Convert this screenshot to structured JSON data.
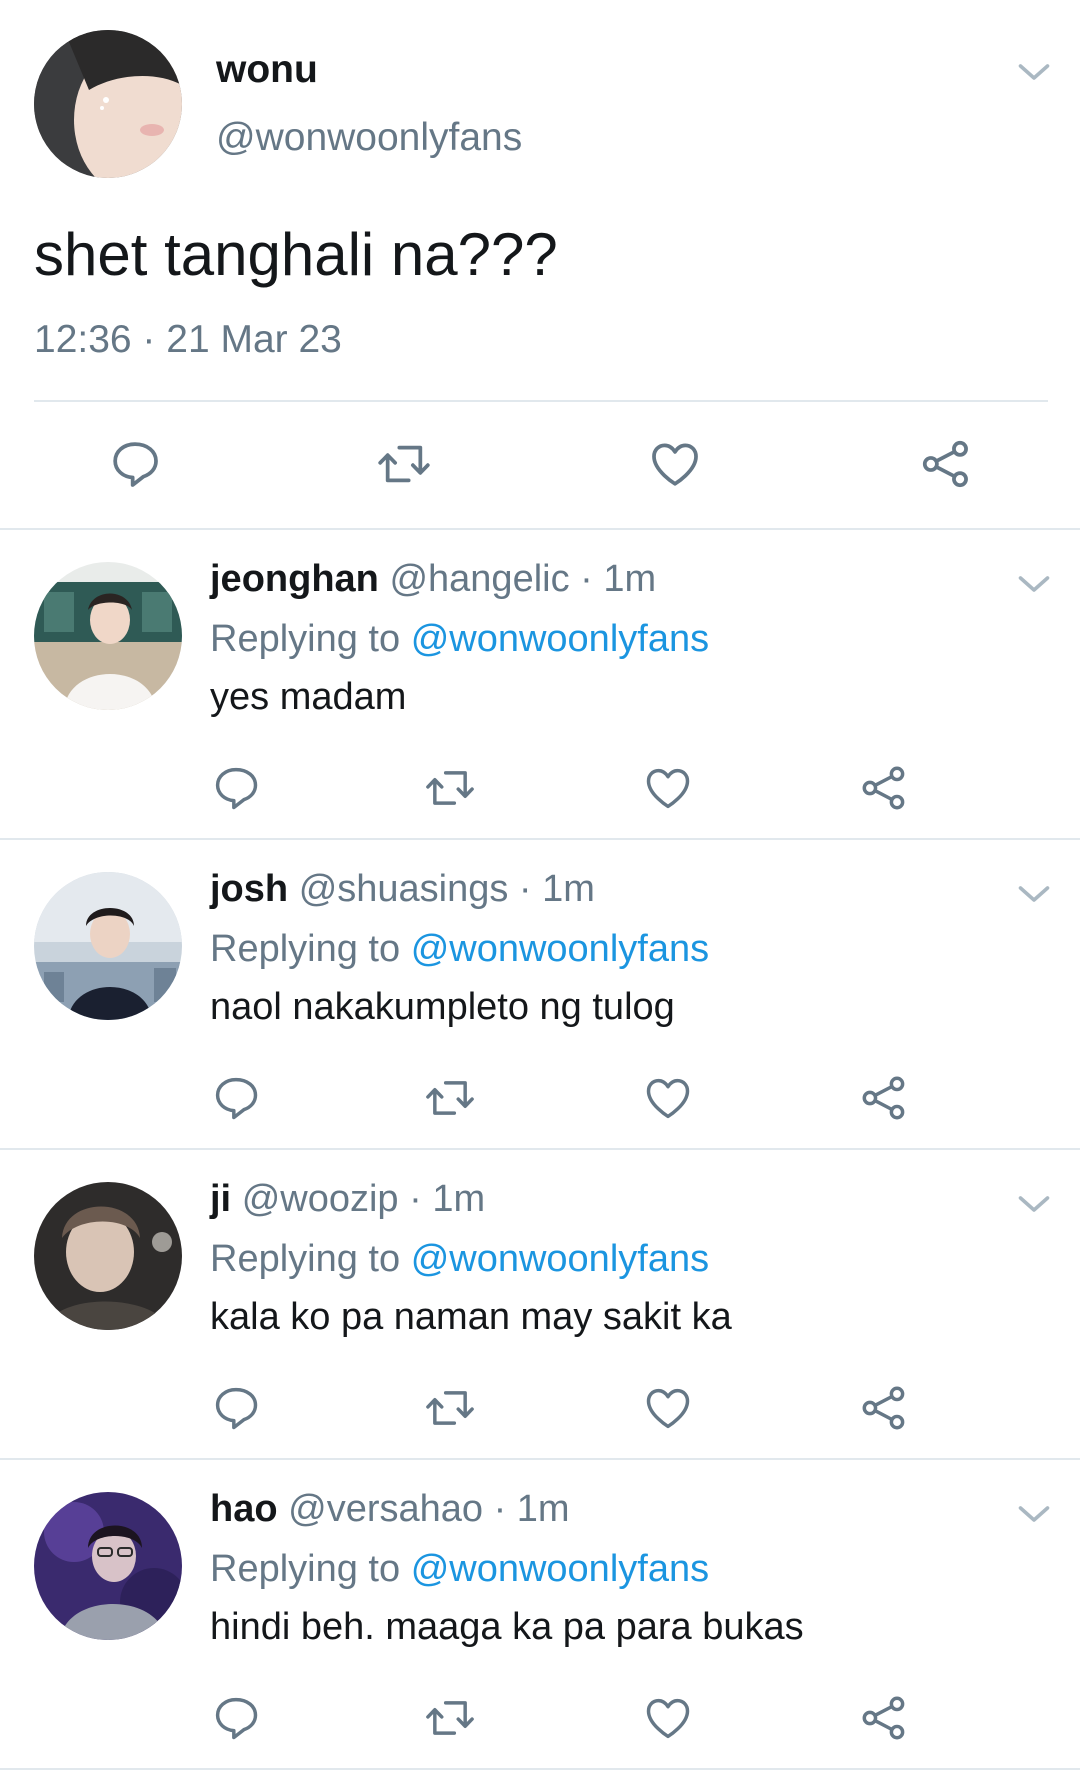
{
  "main": {
    "name": "wonu",
    "handle": "@wonwoonlyfans",
    "text": "shet tanghali na???",
    "timestamp": "12:36 · 21 Mar 23"
  },
  "replies": [
    {
      "name": "jeonghan",
      "meta": "@hangelic · 1m",
      "replying_label": "Replying to",
      "replying_to": "@wonwoonlyfans",
      "text": "yes madam"
    },
    {
      "name": "josh",
      "meta": "@shuasings · 1m",
      "replying_label": "Replying to",
      "replying_to": "@wonwoonlyfans",
      "text": "naol nakakumpleto ng tulog"
    },
    {
      "name": "ji",
      "meta": "@woozip · 1m",
      "replying_label": "Replying to",
      "replying_to": "@wonwoonlyfans",
      "text": "kala ko pa naman may sakit ka"
    },
    {
      "name": "hao",
      "meta": "@versahao · 1m",
      "replying_label": "Replying to",
      "replying_to": "@wonwoonlyfans",
      "text": "hindi beh. maaga ka pa para bukas"
    }
  ],
  "colors": {
    "text": "#14171a",
    "secondary": "#657786",
    "link": "#1b95e0",
    "divider": "#e1e8ed"
  },
  "icons": [
    "reply-icon",
    "retweet-icon",
    "like-icon",
    "share-icon",
    "chevron-down-icon"
  ]
}
